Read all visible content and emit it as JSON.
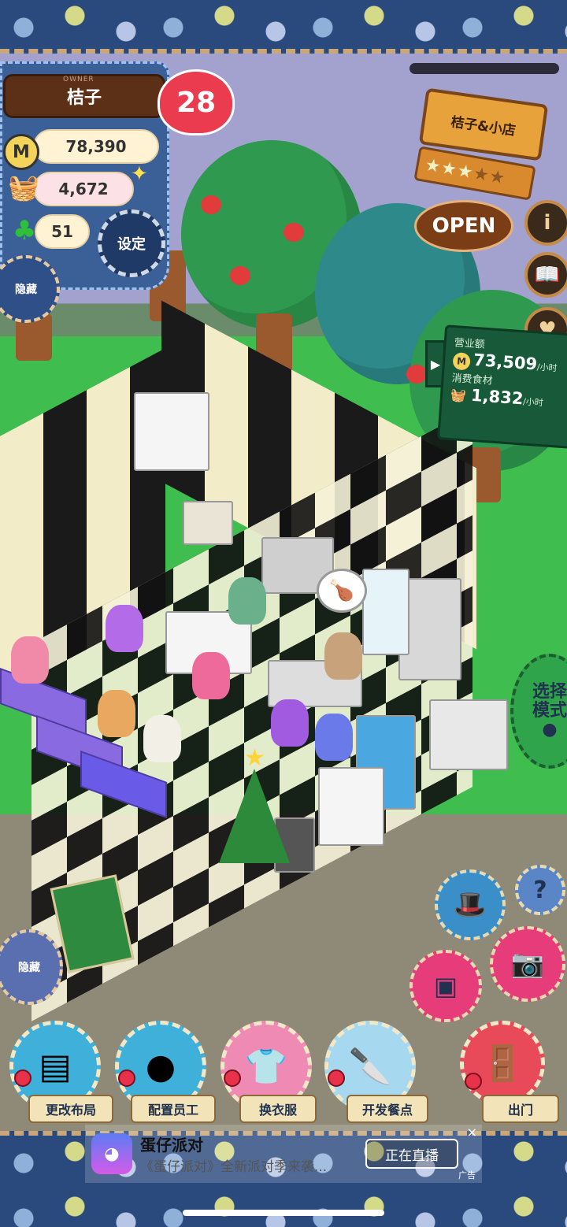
{
  "owner": {
    "tag": "OWNER",
    "name": "桔子",
    "coins": "78,390",
    "ingredients": "4,672",
    "clovers": "51",
    "level_badge": "28",
    "settings_label": "设定",
    "hide_label": "隐藏"
  },
  "shop": {
    "name": "桔子&小店",
    "stars_on": 3,
    "stars_total": 5,
    "open_label": "OPEN"
  },
  "side_buttons": {
    "info_icon": "i",
    "book_icon": "book-icon",
    "heart_icon": "heart-icon"
  },
  "revenue": {
    "sales_label": "营业额",
    "sales_value": "73,509",
    "sales_unit": "/小时",
    "consumption_label": "消费食材",
    "consumption_value": "1,832",
    "consumption_unit": "/小时"
  },
  "mode_button": {
    "label_line1": "选择",
    "label_line2": "模式"
  },
  "tools": {
    "help_label": "?",
    "hide_label": "隐藏"
  },
  "menu": [
    {
      "label": "更改布局",
      "icon": "table-icon"
    },
    {
      "label": "配置员工",
      "icon": "bear-head-icon"
    },
    {
      "label": "换衣服",
      "icon": "shirt-icon"
    },
    {
      "label": "开发餐点",
      "icon": "knife-icon"
    },
    {
      "label": "出门",
      "icon": "door-icon"
    }
  ],
  "ad": {
    "title": "蛋仔派对",
    "description": "《蛋仔派对》全新派对季来袭...",
    "cta": "正在直播",
    "tag": "广告",
    "close": "×"
  },
  "colors": {
    "quilt_blue": "#2a4a7e",
    "grass": "#3fbd4f",
    "heart_red": "#ea3b4f",
    "revenue_green": "#18593a"
  }
}
